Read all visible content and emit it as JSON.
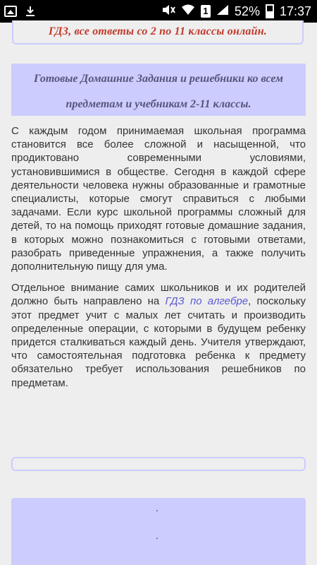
{
  "status_bar": {
    "battery_percent": "52%",
    "time": "17:37",
    "sim_badge": "1"
  },
  "top_banner": {
    "text": "ГДЗ, все ответы со 2 по 11 классы онлайн."
  },
  "header": {
    "title": "Готовые Домашние Задания и решебники ко всем предметам и учебникам 2-11 классы."
  },
  "article": {
    "paragraph1": "С каждым годом принимаемая школьная программа становится все более сложной и насыщенной, что продиктовано современными условиями, установившимися в обществе. Сегодня в каждой сфере деятельности человека нужны образованные и грамотные специалисты, которые смогут справиться с любыми задачами. Если курс школьной программы сложный для детей, то на помощь приходят готовые домашние задания, в которых можно познакомиться с готовыми ответами, разобрать приведенные упражнения, а также получить дополнительную пищу для ума.",
    "paragraph2_before": "Отдельное внимание самих школьников и их родителей должно быть направлено на ",
    "paragraph2_link": "ГДЗ по алгебре",
    "paragraph2_after": ", поскольку этот предмет учит с малых лет считать и производить определенные операции, с которыми в будущем ребенку придется сталкиваться каждый день. Учителя утверждают, что самостоятельная подготовка ребенка к предмету обязательно требует использования решебников по предметам."
  },
  "footer": {
    "dot_a": ".",
    "dot_b": "."
  },
  "colors": {
    "accent_box": "#ccccff",
    "banner_text": "#c0392b",
    "link": "#5b5bd6",
    "page_bg": "#eeeeee"
  }
}
